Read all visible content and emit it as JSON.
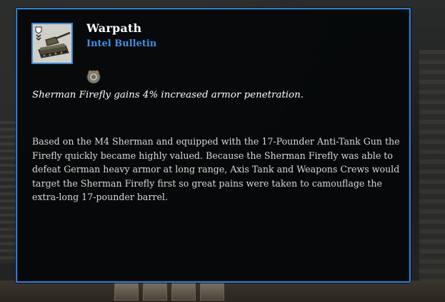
{
  "tooltip": {
    "title": "Warpath",
    "subtitle": "Intel Bulletin",
    "effect": "Sherman Firefly gains 4% increased armor penetration.",
    "description": "Based on the M4 Sherman and equipped with the 17-Pounder Anti-Tank Gun the Firefly quickly became highly valued. Because the Sherman Firefly was able to defeat German heavy armor at long range, Axis Tank and Weapons Crews would target the Sherman Firefly first so great pains were taken to camouflage the extra-long 17-pounder barrel.",
    "icon": "sherman-tank-icon",
    "rank_icon": "bronze-medal-icon"
  },
  "colors": {
    "border": "#2d7fd4",
    "subtitle": "#3f8fe6",
    "panel_bg": "#040608"
  }
}
